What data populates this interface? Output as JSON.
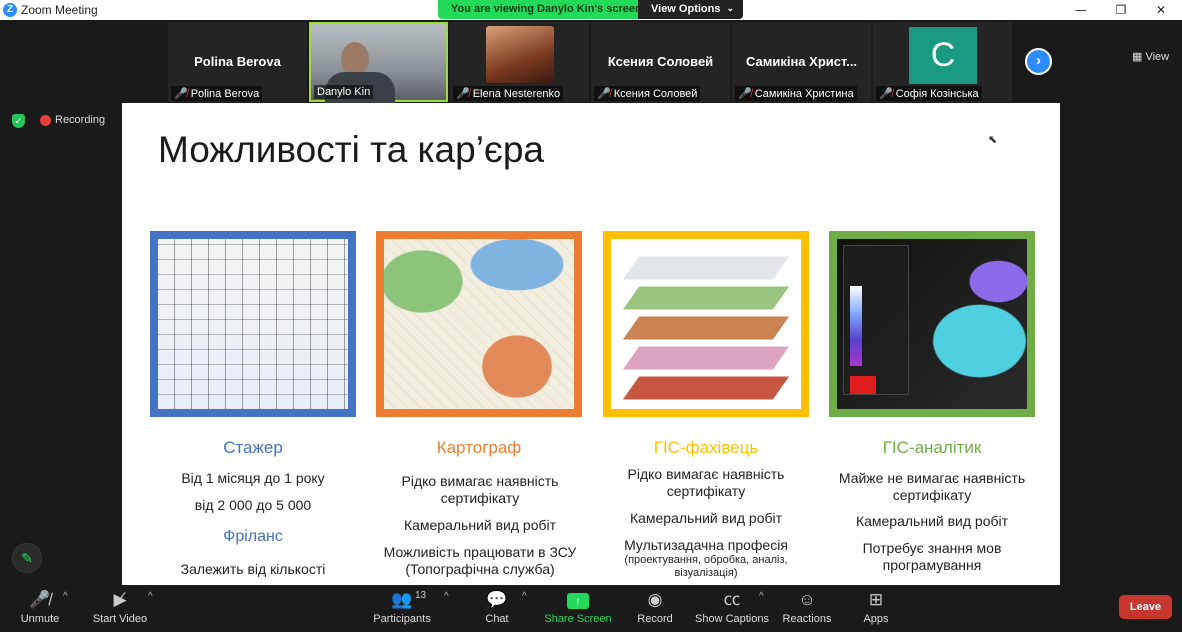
{
  "window": {
    "title": "Zoom Meeting",
    "min": "—",
    "restore": "❐",
    "close": "✕"
  },
  "banner": {
    "text": "You are viewing Danylo Kin's screen",
    "view_options": "View Options"
  },
  "gallery": [
    {
      "name": "Polina Berova",
      "label": "Polina Berova",
      "muted": true
    },
    {
      "name": "",
      "label": "Danylo Kin",
      "muted": false
    },
    {
      "name": "",
      "label": "Elena Nesterenko",
      "muted": true
    },
    {
      "name": "Ксения Соловей",
      "label": "Ксения Соловей",
      "muted": true
    },
    {
      "name": "Самикіна  Христ...",
      "label": "Самикіна Христина",
      "muted": true
    },
    {
      "name": "",
      "label": "Софія Козінська",
      "muted": true,
      "letter": "C"
    }
  ],
  "view_button": "View",
  "recording": "Recording",
  "slide": {
    "title": "Можливості та кар’єра",
    "columns": [
      {
        "title": "Стажер",
        "color": "#4472c4",
        "lines": [
          "Від 1 місяця до 1 року",
          "від 2 000 до 5 000"
        ],
        "subtitle": "Фріланс",
        "sublines": [
          "Залежить від кількості"
        ]
      },
      {
        "title": "Картограф",
        "color": "#ed7d31",
        "lines": [
          "Рідко вимагає наявність сертифікату",
          "Камеральний вид робіт",
          "Можливість працювати в ЗСУ (Топографічна служба)"
        ]
      },
      {
        "title": "ГІС-фахівець",
        "color": "#ffc000",
        "lines": [
          "Рідко вимагає наявність сертифікату",
          "Камеральний вид робіт",
          "Мультизадачна професія",
          "(проектування, обробка, аналіз, візуалізація)"
        ]
      },
      {
        "title": "ГІС-аналітик",
        "color": "#70ad47",
        "lines": [
          "Майже не вимагає наявність сертифікату",
          "Камеральний вид робіт",
          "Потребує знання мов програмування"
        ]
      }
    ]
  },
  "toolbar": {
    "unmute": "Unmute",
    "start_video": "Start Video",
    "participants": "Participants",
    "participants_count": "13",
    "chat": "Chat",
    "share_screen": "Share Screen",
    "record": "Record",
    "show_captions": "Show Captions",
    "reactions": "Reactions",
    "apps": "Apps",
    "leave": "Leave"
  }
}
